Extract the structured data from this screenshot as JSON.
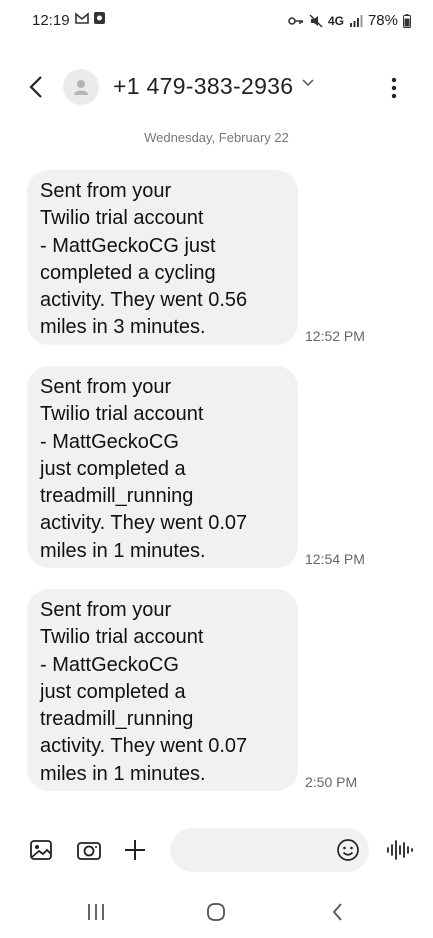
{
  "status_bar": {
    "time": "12:19",
    "network": "4G",
    "battery": "78%"
  },
  "header": {
    "contact": "+1 479-383-2936"
  },
  "conversation": {
    "date": "Wednesday, February 22",
    "messages": [
      {
        "text": "Sent from your\nTwilio trial account\n- MattGeckoCG just\ncompleted a cycling\nactivity. They went 0.56\nmiles in 3 minutes.",
        "time": "12:52 PM"
      },
      {
        "text": "Sent from your\nTwilio trial account\n- MattGeckoCG\njust completed a\ntreadmill_running\nactivity. They went 0.07\nmiles in 1 minutes.",
        "time": "12:54 PM"
      },
      {
        "text": "Sent from your\nTwilio trial account\n- MattGeckoCG\njust completed a\ntreadmill_running\nactivity. They went 0.07\nmiles in 1 minutes.",
        "time": "2:50 PM"
      }
    ]
  },
  "composer": {
    "placeholder": ""
  },
  "icons": {
    "status_left": [
      "gmail-icon",
      "app-notification-icon"
    ],
    "status_right": [
      "key-icon",
      "mute-icon",
      "signal-icon",
      "battery-icon"
    ],
    "header": [
      "back-icon",
      "avatar-icon",
      "chevron-down-icon",
      "more-vert-icon"
    ],
    "composer": [
      "gallery-icon",
      "camera-icon",
      "plus-icon",
      "emoji-icon",
      "voice-icon"
    ],
    "nav": [
      "recents-icon",
      "home-icon",
      "back-icon"
    ]
  }
}
